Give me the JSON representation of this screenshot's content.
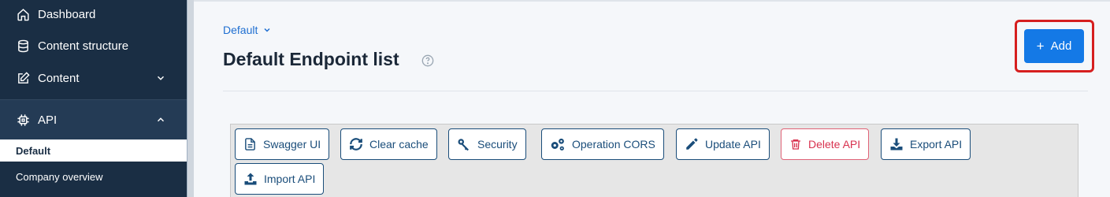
{
  "sidebar": {
    "items": [
      {
        "label": "Dashboard",
        "icon": "home-icon"
      },
      {
        "label": "Content structure",
        "icon": "database-icon"
      },
      {
        "label": "Content",
        "icon": "edit-icon"
      },
      {
        "label": "API",
        "icon": "chip-icon"
      }
    ],
    "sub_items": [
      {
        "label": "Default"
      },
      {
        "label": "Company overview"
      }
    ]
  },
  "header": {
    "breadcrumb": "Default",
    "title": "Default Endpoint list",
    "add_label": "Add"
  },
  "toolbar": {
    "buttons": [
      {
        "label": "Swagger UI",
        "icon": "document-icon"
      },
      {
        "label": "Clear cache",
        "icon": "refresh-icon"
      },
      {
        "label": "Security",
        "icon": "key-icon"
      },
      {
        "label": "Operation CORS",
        "icon": "gears-icon"
      },
      {
        "label": "Update API",
        "icon": "pencil-icon"
      },
      {
        "label": "Delete API",
        "icon": "trash-icon"
      },
      {
        "label": "Export API",
        "icon": "download-icon"
      },
      {
        "label": "Import API",
        "icon": "upload-icon"
      }
    ]
  },
  "colors": {
    "sidebar_bg": "#1a2e44",
    "primary": "#1479e6",
    "danger": "#d8324f",
    "highlight": "#d61f1f"
  }
}
